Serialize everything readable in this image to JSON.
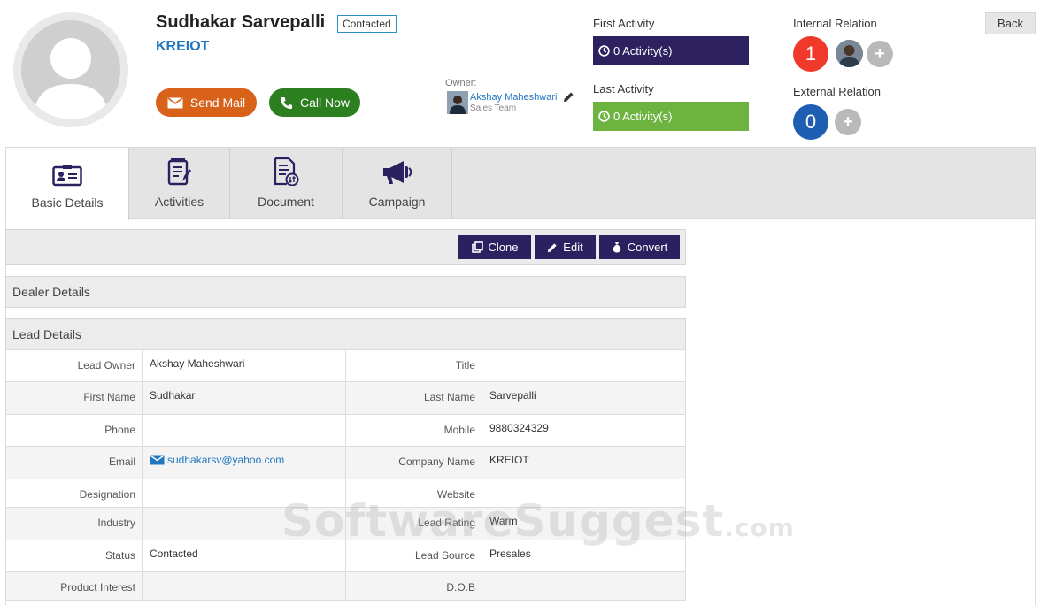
{
  "lead": {
    "name": "Sudhakar Sarvepalli",
    "status": "Contacted",
    "company": "KREIOT"
  },
  "actions": {
    "send_mail": "Send Mail",
    "call_now": "Call Now",
    "back": "Back"
  },
  "owner": {
    "label": "Owner:",
    "name": "Akshay Maheshwari",
    "team": "Sales Team"
  },
  "activity": {
    "first_label": "First Activity",
    "first_value": "0 Activity(s)",
    "last_label": "Last Activity",
    "last_value": "0 Activity(s)"
  },
  "relations": {
    "internal_label": "Internal Relation",
    "internal_count": "1",
    "external_label": "External Relation",
    "external_count": "0"
  },
  "tabs": [
    {
      "label": "Basic Details",
      "icon": "id-card-icon"
    },
    {
      "label": "Activities",
      "icon": "notepad-icon"
    },
    {
      "label": "Document",
      "icon": "document-icon"
    },
    {
      "label": "Campaign",
      "icon": "megaphone-icon"
    }
  ],
  "toolbar": {
    "clone": "Clone",
    "edit": "Edit",
    "convert": "Convert"
  },
  "sections": {
    "dealer": "Dealer Details",
    "lead": "Lead Details"
  },
  "details": [
    {
      "l1": "Lead Owner",
      "v1": "Akshay Maheshwari",
      "l2": "Title",
      "v2": ""
    },
    {
      "l1": "First Name",
      "v1": "Sudhakar",
      "l2": "Last Name",
      "v2": "Sarvepalli"
    },
    {
      "l1": "Phone",
      "v1": "",
      "l2": "Mobile",
      "v2": "9880324329"
    },
    {
      "l1": "Email",
      "v1": "sudhakarsv@yahoo.com",
      "l2": "Company Name",
      "v2": "KREIOT"
    },
    {
      "l1": "Designation",
      "v1": "",
      "l2": "Website",
      "v2": ""
    },
    {
      "l1": "Industry",
      "v1": "",
      "l2": "Lead Rating",
      "v2": "Warm"
    },
    {
      "l1": "Status",
      "v1": "Contacted",
      "l2": "Lead Source",
      "v2": "Presales"
    },
    {
      "l1": "Product Interest",
      "v1": "",
      "l2": "D.O.B",
      "v2": ""
    }
  ],
  "watermark": "SoftwareSuggest",
  "watermark_suffix": ".com",
  "colors": {
    "first_activity": "#2d2160",
    "last_activity": "#6cb33f",
    "internal_badge": "#f0392b",
    "external_badge": "#1e5fb3",
    "mail_button": "#d9621a",
    "call_button": "#2b7f1f",
    "toolbar_button": "#2b2160",
    "link": "#1f77c2"
  }
}
